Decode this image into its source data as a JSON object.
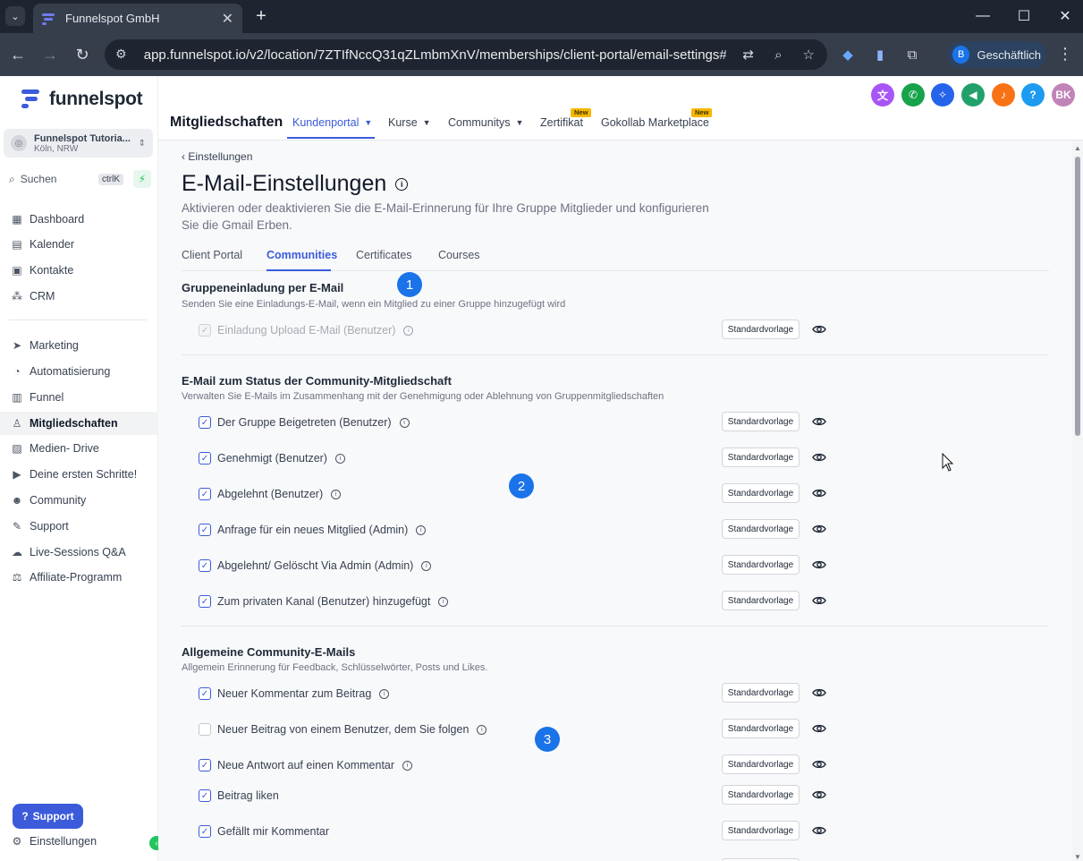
{
  "browser": {
    "tab_title": "Funnelspot GmbH",
    "url": "app.funnelspot.io/v2/location/7ZTIfNccQ31qZLmbmXnV/memberships/client-portal/email-settings#com...",
    "profile_letter": "B",
    "profile_label": "Geschäftlich"
  },
  "sidebar": {
    "brand": "funnelspot",
    "location_name": "Funnelspot Tutoria...",
    "location_city": "Köln, NRW",
    "search_placeholder": "Suchen",
    "search_shortcut": "ctrlK",
    "items": [
      {
        "label": "Dashboard",
        "icon": "grid-icon"
      },
      {
        "label": "Kalender",
        "icon": "calendar-icon"
      },
      {
        "label": "Kontakte",
        "icon": "contacts-icon"
      },
      {
        "label": "CRM",
        "icon": "crm-icon"
      },
      {
        "label": "Marketing",
        "icon": "send-icon"
      },
      {
        "label": "Automatisierung",
        "icon": "automation-icon"
      },
      {
        "label": "Funnel",
        "icon": "funnel-icon"
      },
      {
        "label": "Mitgliedschaften",
        "icon": "award-icon",
        "active": true
      },
      {
        "label": "Medien- Drive",
        "icon": "image-icon"
      },
      {
        "label": "Deine ersten Schritte!",
        "icon": "play-icon"
      },
      {
        "label": "Community",
        "icon": "users-icon"
      },
      {
        "label": "Support",
        "icon": "wrench-icon"
      },
      {
        "label": "Live-Sessions Q&A",
        "icon": "chat-icon"
      },
      {
        "label": "Affiliate-Programm",
        "icon": "affiliate-icon"
      }
    ],
    "support_button": "Support",
    "settings_label": "Einstellungen"
  },
  "header": {
    "title": "Mitgliedschaften",
    "nav": [
      {
        "label": "Kundenportal",
        "dropdown": true,
        "active": true
      },
      {
        "label": "Kurse",
        "dropdown": true
      },
      {
        "label": "Communitys",
        "dropdown": true
      },
      {
        "label": "Zertifikat",
        "badge": "New"
      },
      {
        "label": "Gokollab Marketplace",
        "badge": "New"
      }
    ],
    "avatar_initials": "BK"
  },
  "page": {
    "back_label": "Einstellungen",
    "title": "E-Mail-Einstellungen",
    "description": "Aktivieren oder deaktivieren Sie die E-Mail-Erinnerung für Ihre Gruppe Mitglieder und konfigurieren Sie die Gmail Erben.",
    "tabs": [
      "Client Portal",
      "Communities",
      "Certificates",
      "Courses"
    ],
    "active_tab": "Communities",
    "template_label": "Standardvorlage",
    "sections": [
      {
        "title": "Gruppeneinladung per E-Mail",
        "subtitle": "Senden Sie eine Einladungs-E-Mail, wenn ein Mitglied zu einer Gruppe hinzugefügt wird",
        "rows": [
          {
            "label": "Einladung Upload E-Mail (Benutzer)",
            "checked": true,
            "disabled": true
          }
        ]
      },
      {
        "title": "E-Mail zum Status der Community-Mitgliedschaft",
        "subtitle": "Verwalten Sie E-Mails im Zusammenhang mit der Genehmigung oder Ablehnung von Gruppenmitgliedschaften",
        "rows": [
          {
            "label": "Der Gruppe Beigetreten (Benutzer)",
            "checked": true
          },
          {
            "label": "Genehmigt (Benutzer)",
            "checked": true
          },
          {
            "label": "Abgelehnt (Benutzer)",
            "checked": true
          },
          {
            "label": "Anfrage für ein neues Mitglied (Admin)",
            "checked": true
          },
          {
            "label": "Abgelehnt/ Gelöscht Via Admin (Admin)",
            "checked": true
          },
          {
            "label": "Zum privaten Kanal (Benutzer) hinzugefügt",
            "checked": true
          }
        ]
      },
      {
        "title": "Allgemeine Community-E-Mails",
        "subtitle": "Allgemein Erinnerung für Feedback, Schlüsselwörter, Posts und Likes.",
        "rows": [
          {
            "label": "Neuer Kommentar zum Beitrag",
            "checked": true
          },
          {
            "label": "Neuer Beitrag von einem Benutzer, dem Sie folgen",
            "checked": false
          },
          {
            "label": "Neue Antwort auf einen Kommentar",
            "checked": true
          },
          {
            "label": "Beitrag liken",
            "checked": true,
            "no_info": true
          },
          {
            "label": "Gefällt mir Kommentar",
            "checked": true,
            "no_info": true
          }
        ]
      }
    ],
    "callouts": [
      "1",
      "2",
      "3"
    ]
  }
}
